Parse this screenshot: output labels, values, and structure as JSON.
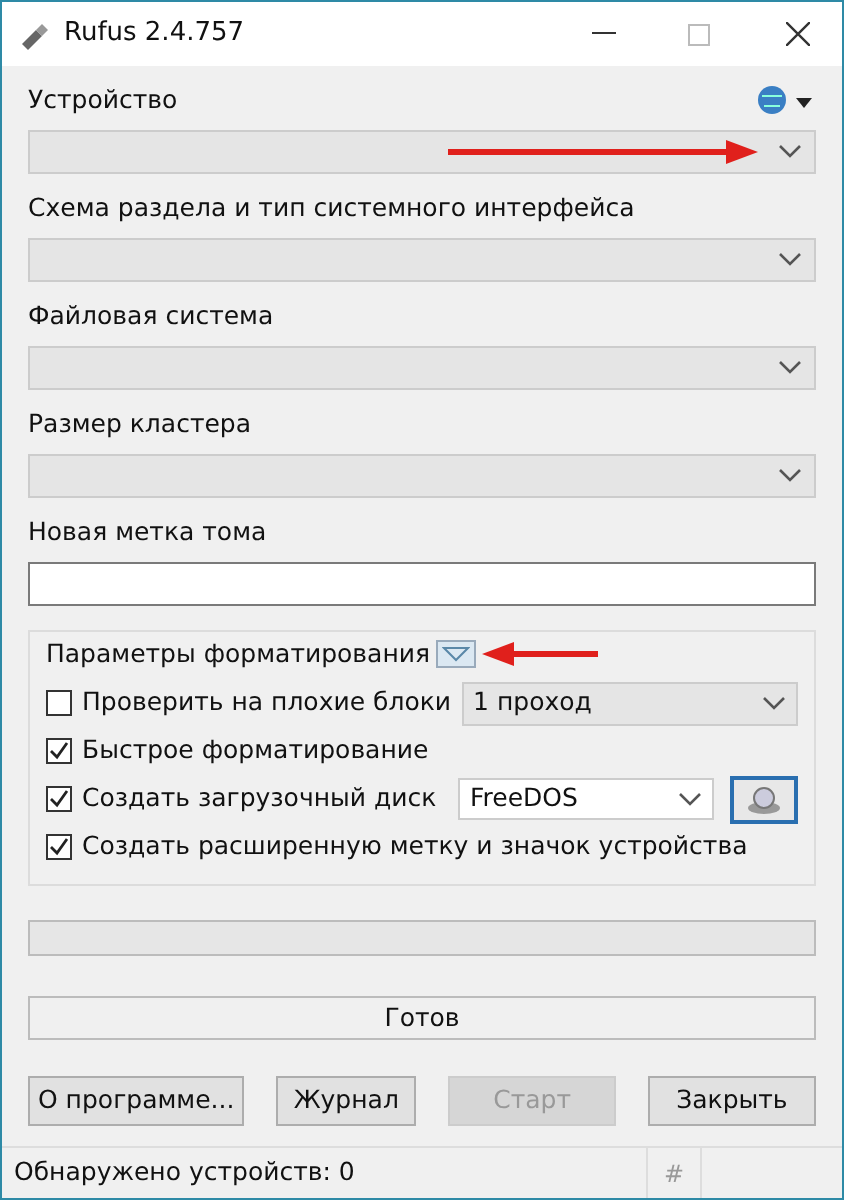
{
  "window": {
    "title": "Rufus 2.4.757"
  },
  "fields": [
    {
      "label": "Устройство",
      "kind": "select"
    },
    {
      "label": "Схема раздела и тип системного интерфейса",
      "kind": "select"
    },
    {
      "label": "Файловая система",
      "kind": "select"
    },
    {
      "label": "Размер кластера",
      "kind": "select"
    },
    {
      "label": "Новая метка тома",
      "kind": "text"
    }
  ],
  "format_options": {
    "title": "Параметры форматирования",
    "options": [
      {
        "label": "Проверить на плохие блоки",
        "checked": false,
        "kind": "select",
        "value": "1 проход"
      },
      {
        "label": "Быстрое форматирование",
        "checked": true,
        "kind": "plain"
      },
      {
        "label": "Создать загрузочный диск",
        "checked": true,
        "kind": "image",
        "value": "FreeDOS"
      },
      {
        "label": "Создать расширенную метку и значок устройства",
        "checked": true,
        "kind": "plain"
      }
    ]
  },
  "status": "Готов",
  "buttons": [
    {
      "label": "О программе...",
      "disabled": false
    },
    {
      "label": "Журнал",
      "disabled": false
    },
    {
      "label": "Старт",
      "disabled": true
    },
    {
      "label": "Закрыть",
      "disabled": false
    }
  ],
  "status_bar": {
    "text": "Обнаружено устройств: 0",
    "hash": "#"
  }
}
